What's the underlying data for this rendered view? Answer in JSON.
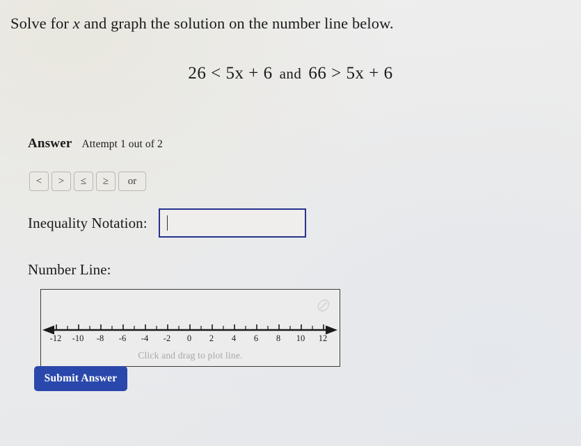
{
  "prompt": {
    "before_var": "Solve for ",
    "variable": "x",
    "after_var": " and graph the solution on the number line below."
  },
  "equation": {
    "left": "26 < 5x + 6",
    "conjunction": "and",
    "right": "66 > 5x + 6"
  },
  "answer": {
    "label": "Answer",
    "attempt": "Attempt 1 out of 2"
  },
  "operators": [
    {
      "name": "less-than",
      "label": "<"
    },
    {
      "name": "greater-than",
      "label": ">"
    },
    {
      "name": "less-than-or-equal",
      "label": "≤"
    },
    {
      "name": "greater-than-or-equal",
      "label": "≥"
    },
    {
      "name": "or",
      "label": "or"
    }
  ],
  "inequality_notation": {
    "label": "Inequality Notation:",
    "value": "",
    "placeholder": ""
  },
  "number_line": {
    "title": "Number Line:",
    "hint": "Click and drag to plot line.",
    "watermark": "⊘",
    "left_arrow": true,
    "right_arrow": true,
    "min": -13,
    "max": 13,
    "major_labels": [
      -12,
      -10,
      -8,
      -6,
      -4,
      -2,
      0,
      2,
      4,
      6,
      8,
      10,
      12
    ],
    "minor_ticks": [
      -13,
      -11,
      -9,
      -7,
      -5,
      -3,
      -1,
      1,
      3,
      5,
      7,
      9,
      11,
      13
    ]
  },
  "submit": {
    "label": "Submit Answer",
    "color": "#2a48ab"
  }
}
